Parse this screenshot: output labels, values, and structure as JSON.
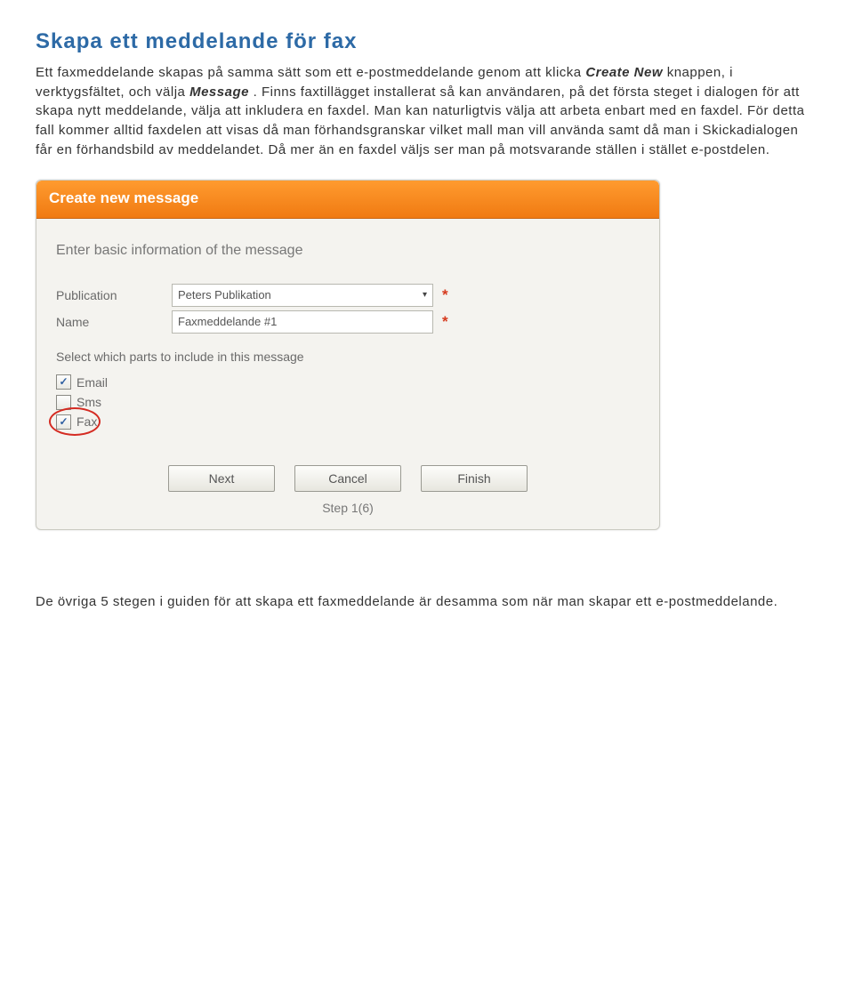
{
  "title": "Skapa ett meddelande för fax",
  "intro_parts": {
    "p1a": "Ett faxmeddelande skapas på samma sätt som ett e-postmeddelande genom att klicka ",
    "p1_em1": "Create New",
    "p1b": " knappen, i verktygsfältet, och välja ",
    "p1_em2": "Message",
    "p1c": ". Finns faxtillägget installerat så kan användaren, på det första steget i dialogen för att skapa nytt meddelande, välja att inkludera en faxdel. Man kan naturligtvis välja att arbeta enbart med en faxdel. För detta fall kommer alltid faxdelen att visas då man förhandsgranskar vilket mall man vill använda samt då man i Skickadialogen får en förhandsbild av meddelandet. Då mer än en faxdel väljs ser man på motsvarande ställen i stället e-postdelen."
  },
  "dialog": {
    "header": "Create new message",
    "enter_info": "Enter basic information of the message",
    "publication_label": "Publication",
    "publication_value": "Peters Publikation",
    "name_label": "Name",
    "name_value": "Faxmeddelande #1",
    "required_mark": "*",
    "parts_label": "Select which parts to include in this message",
    "checks": {
      "email": "Email",
      "sms": "Sms",
      "fax": "Fax"
    },
    "buttons": {
      "next": "Next",
      "cancel": "Cancel",
      "finish": "Finish"
    },
    "step": "Step 1(6)"
  },
  "footer": "De övriga 5 stegen i guiden för att skapa ett faxmeddelande är desamma som när man skapar ett e-postmeddelande."
}
